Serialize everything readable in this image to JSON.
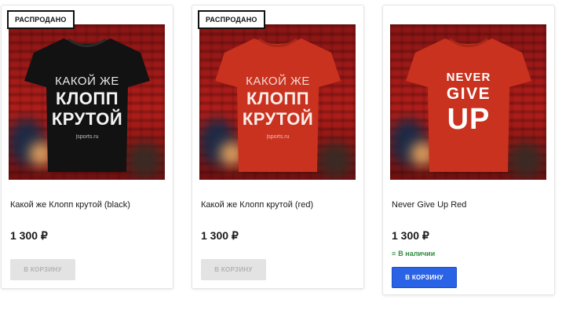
{
  "colors": {
    "accent_blue": "#2b63e6",
    "in_stock_green": "#2e8b3e",
    "tee_black": "#121212",
    "tee_red": "#c9321f"
  },
  "products": [
    {
      "badge": "РАСПРОДАНО",
      "title": "Какой же Клопп крутой (black)",
      "price": "1 300 ₽",
      "button": "В КОРЗИНУ",
      "button_enabled": false,
      "shirt_lines": [
        "КАКОЙ ЖЕ",
        "КЛОПП",
        "КРУТОЙ",
        "|sports.ru"
      ]
    },
    {
      "badge": "РАСПРОДАНО",
      "title": "Какой же Клопп крутой (red)",
      "price": "1 300 ₽",
      "button": "В КОРЗИНУ",
      "button_enabled": false,
      "shirt_lines": [
        "КАКОЙ ЖЕ",
        "КЛОПП",
        "КРУТОЙ",
        "|sports.ru"
      ]
    },
    {
      "title": "Never Give Up Red",
      "price": "1 300 ₽",
      "stock": "В наличии",
      "stock_icon": "in-stock-icon",
      "button": "В КОРЗИНУ",
      "button_enabled": true,
      "shirt_lines": [
        "NEVER",
        "GIVE",
        "UP"
      ]
    }
  ]
}
